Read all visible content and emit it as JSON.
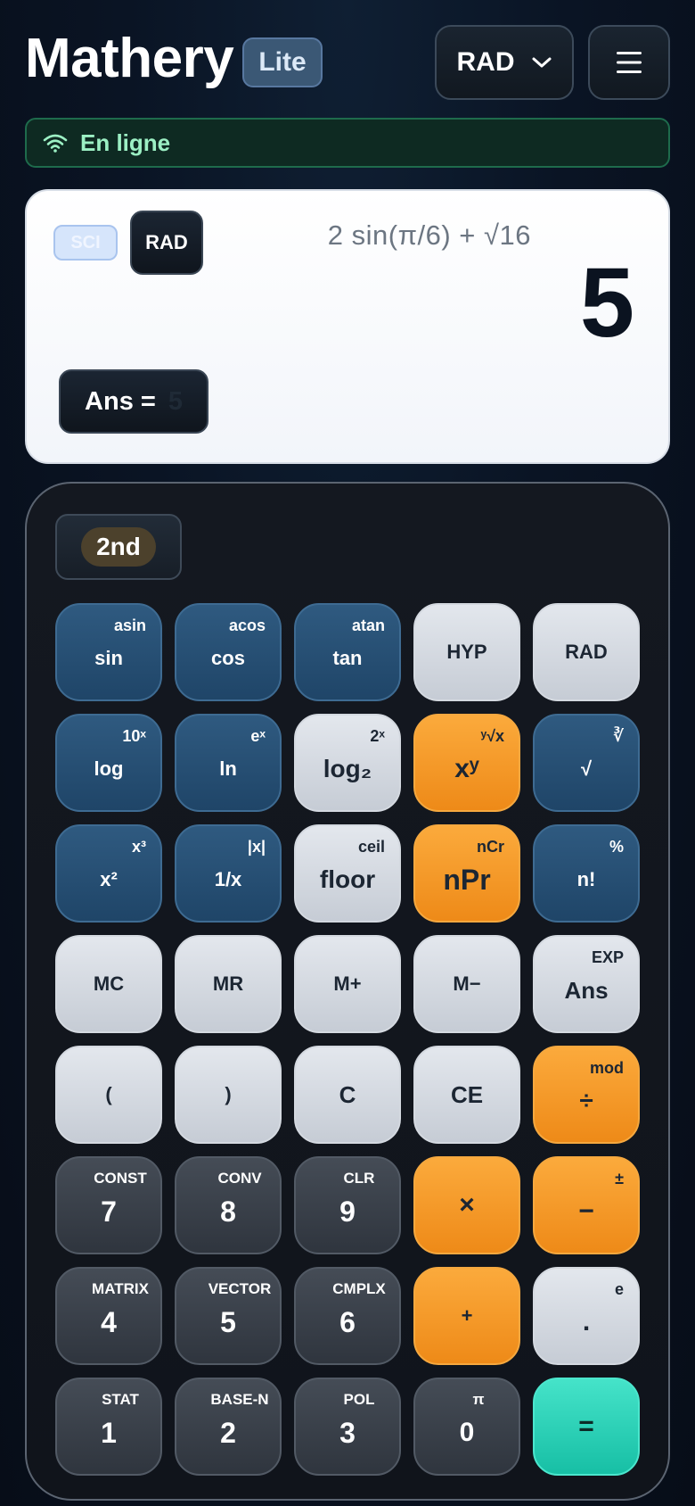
{
  "header": {
    "title": "Mathery",
    "badge": "Lite",
    "mode": "RAD"
  },
  "status": {
    "text": "En ligne"
  },
  "display": {
    "sci_chip": "SCI",
    "rad_chip": "RAD",
    "expression": "2 sin(π/6) + √16",
    "result": "5",
    "ans_label": "Ans =",
    "ans_value": "5"
  },
  "keypad": {
    "second": "2nd",
    "rows": [
      [
        {
          "main": "sin",
          "sub": "asin"
        },
        {
          "main": "cos",
          "sub": "acos"
        },
        {
          "main": "tan",
          "sub": "atan"
        },
        {
          "main": "HYP",
          "sub": ""
        },
        {
          "main": "RAD",
          "sub": ""
        }
      ],
      [
        {
          "main": "log",
          "sub": "10ˣ"
        },
        {
          "main": "ln",
          "sub": "eˣ"
        },
        {
          "main": "log₂",
          "sub": "2ˣ"
        },
        {
          "main": "xʸ",
          "sub": "ʸ√x"
        },
        {
          "main": "√",
          "sub": "∛"
        }
      ],
      [
        {
          "main": "x²",
          "sub": "x³"
        },
        {
          "main": "1/x",
          "sub": "|x|"
        },
        {
          "main": "floor",
          "sub": "ceil"
        },
        {
          "main": "nPr",
          "sub": "nCr"
        },
        {
          "main": "n!",
          "sub": "%"
        }
      ],
      [
        {
          "main": "MC",
          "sub": ""
        },
        {
          "main": "MR",
          "sub": ""
        },
        {
          "main": "M+",
          "sub": ""
        },
        {
          "main": "M−",
          "sub": ""
        },
        {
          "main": "Ans",
          "sub": "EXP"
        }
      ],
      [
        {
          "main": "(",
          "sub": ""
        },
        {
          "main": ")",
          "sub": ""
        },
        {
          "main": "C",
          "sub": ""
        },
        {
          "main": "CE",
          "sub": ""
        },
        {
          "main": "÷",
          "sub": "mod"
        }
      ],
      [
        {
          "main": "7",
          "sub": "CONST"
        },
        {
          "main": "8",
          "sub": "CONV"
        },
        {
          "main": "9",
          "sub": "CLR"
        },
        {
          "main": "×",
          "sub": ""
        },
        {
          "main": "−",
          "sub": "±"
        }
      ],
      [
        {
          "main": "4",
          "sub": "MATRIX"
        },
        {
          "main": "5",
          "sub": "VECTOR"
        },
        {
          "main": "6",
          "sub": "CMPLX"
        },
        {
          "main": "+",
          "sub": ""
        },
        {
          "main": ".",
          "sub": "e"
        }
      ],
      [
        {
          "main": "1",
          "sub": "STAT"
        },
        {
          "main": "2",
          "sub": "BASE-N"
        },
        {
          "main": "3",
          "sub": "POL"
        },
        {
          "main": "0",
          "sub": "π"
        },
        {
          "main": "=",
          "sub": ""
        }
      ]
    ]
  },
  "colors": {
    "blue_key": "#2f5a80",
    "light_key": "#d6dae1",
    "orange_key": "#f59b2a",
    "dark_key": "#3a4049",
    "teal_key": "#2fd3b8",
    "online_green": "#9cf0c4"
  },
  "icons": {
    "mode_dropdown": "chevron-down-icon",
    "menu": "hamburger-menu-icon",
    "status": "wifi-icon"
  }
}
